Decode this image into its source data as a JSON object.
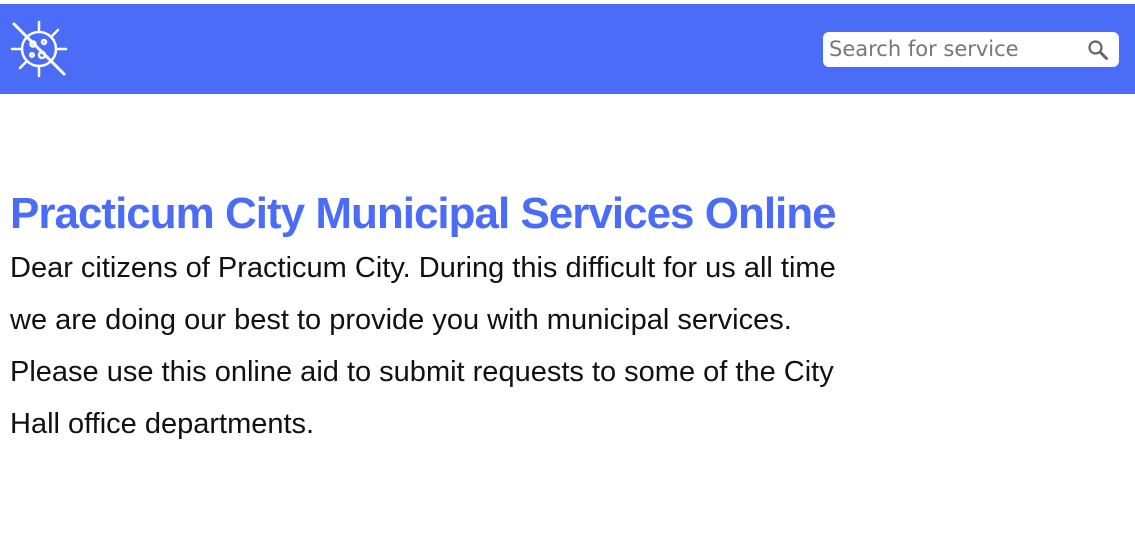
{
  "header": {
    "logo_name": "crossed-out-virus-icon",
    "brand_color": "#4a6cf7"
  },
  "search": {
    "placeholder": "Search for service",
    "value": "",
    "icon": "search-icon"
  },
  "main": {
    "title": "Practicum City Municipal Services Online",
    "paragraph1": "Dear citizens of Practicum City. During this difficult for us all time we are doing our best to provide you with municipal services.",
    "paragraph2": "Please use this online aid to submit requests to some of the City Hall office departments."
  }
}
